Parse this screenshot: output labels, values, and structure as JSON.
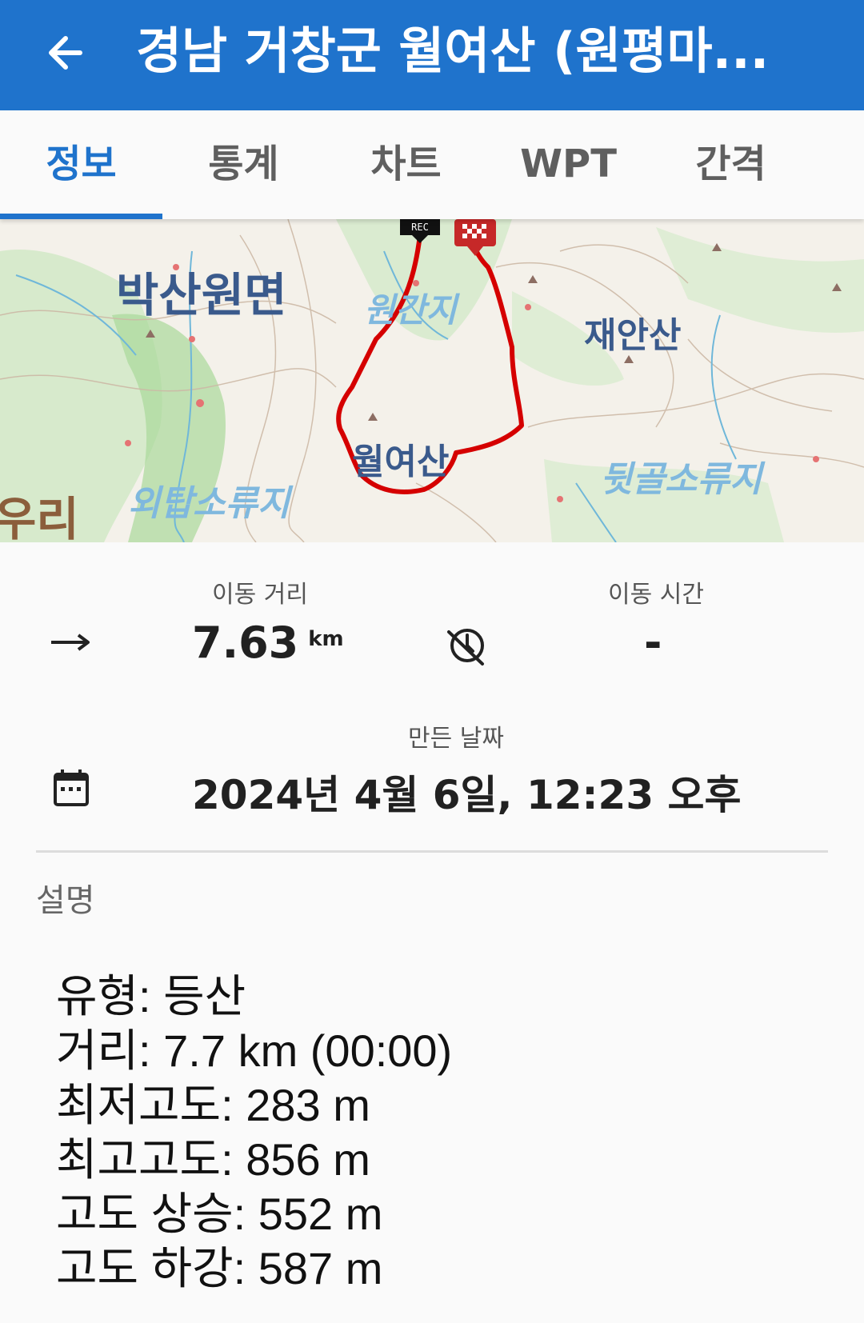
{
  "appbar": {
    "title": "경남 거창군 월여산 (원평마...",
    "back_icon": "arrow-left-icon",
    "background": "#1f73cc"
  },
  "tabs": [
    {
      "label": "정보",
      "active": true
    },
    {
      "label": "통계",
      "active": false
    },
    {
      "label": "차트",
      "active": false
    },
    {
      "label": "WPT",
      "active": false
    },
    {
      "label": "간격",
      "active": false
    }
  ],
  "map": {
    "labels": {
      "baksanwon": "박산원면",
      "wonganji": "원간지",
      "jaeansan": "재안산",
      "wolyeosan": "월여산",
      "oetap": "외탑소류지",
      "dwitgol": "뒷골소류지",
      "uri": "우리"
    },
    "markers": {
      "rec": "REC",
      "finish_icon": "checkered-flag-icon"
    },
    "track_color": "#d50000"
  },
  "stats": {
    "distance": {
      "label": "이동 거리",
      "value": "7.63",
      "unit": "km",
      "icon": "arrow-right-icon"
    },
    "moving_time": {
      "label": "이동 시간",
      "value": "-",
      "icon": "timer-off-icon"
    },
    "created": {
      "label": "만든 날짜",
      "value": "2024년 4월 6일, 12:23 오후",
      "icon": "calendar-icon"
    }
  },
  "description": {
    "title": "설명",
    "lines": [
      "유형: 등산",
      "거리: 7.7 km (00:00)",
      "최저고도: 283 m",
      "최고고도: 856 m",
      "고도 상승: 552 m",
      "고도 하강: 587 m"
    ]
  }
}
